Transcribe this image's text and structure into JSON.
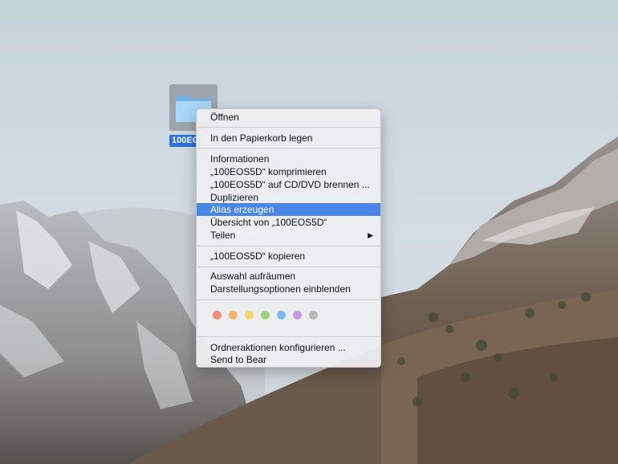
{
  "folder": {
    "name": "100EOS5D"
  },
  "context_menu": {
    "items": [
      {
        "label": "Öffnen"
      },
      {
        "label": "In den Papierkorb legen"
      },
      {
        "label": "Informationen"
      },
      {
        "label": "„100EOS5D“ komprimieren"
      },
      {
        "label": "„100EOS5D“ auf CD/DVD brennen ..."
      },
      {
        "label": "Duplizieren"
      },
      {
        "label": "Alias erzeugen"
      },
      {
        "label": "Übersicht von „100EOS5D“"
      },
      {
        "label": "Teilen",
        "submenu_arrow": "▶"
      },
      {
        "label": "„100EOS5D“ kopieren"
      },
      {
        "label": "Auswahl aufräumen"
      },
      {
        "label": "Darstellungsoptionen einblenden"
      },
      {
        "label": "Ordneraktionen konfigurieren ..."
      },
      {
        "label": "Send to Bear"
      }
    ],
    "highlighted_item": "Alias erzeugen",
    "tag_colors": [
      "#f28b82",
      "#f4b36c",
      "#f2d86b",
      "#9ad27f",
      "#7fb8f0",
      "#c99ae4",
      "#b9b9b9"
    ],
    "highlight_color": "#4a86e8"
  }
}
